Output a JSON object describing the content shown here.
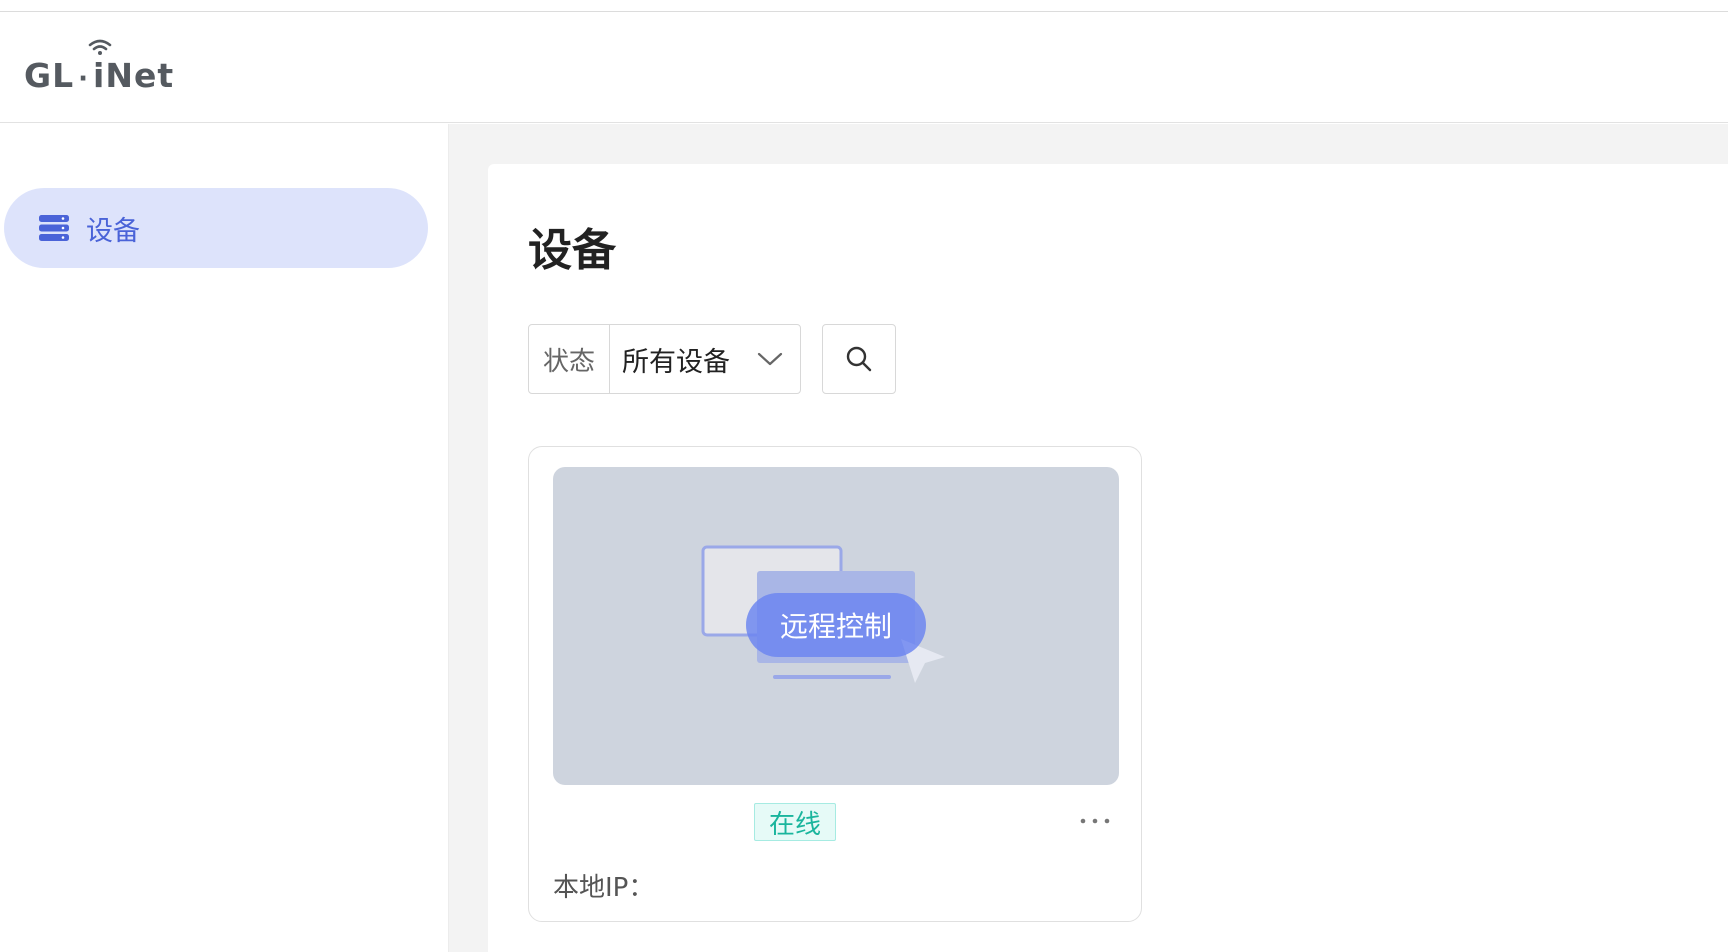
{
  "header": {
    "logo_part1": "GL",
    "logo_dot": "·",
    "logo_i": "i",
    "logo_part2": "Net"
  },
  "sidebar": {
    "items": [
      {
        "label": "设备",
        "icon": "server-icon",
        "active": true
      }
    ]
  },
  "main": {
    "title": "设备",
    "filter": {
      "label": "状态",
      "selected": "所有设备"
    },
    "search_icon": "search-icon",
    "devices": [
      {
        "action_label": "远程控制",
        "status": "在线",
        "ip_label": "本地IP：",
        "ip_value": "",
        "more_icon": "more-dots-icon"
      }
    ]
  },
  "colors": {
    "accent": "#4a63d8",
    "nav_active_bg": "#dde3fb",
    "online": "#1ab59d",
    "content_bg": "#f3f3f3"
  }
}
